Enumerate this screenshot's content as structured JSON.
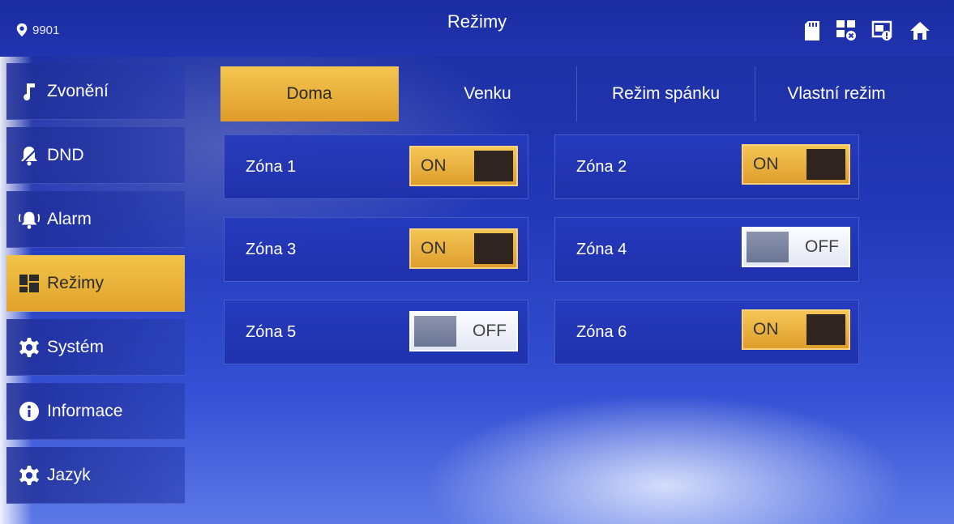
{
  "header": {
    "location_id": "9901",
    "title": "Režimy"
  },
  "status_icons": [
    "sd-card-icon",
    "network-error-icon",
    "camera-alert-icon",
    "home-icon"
  ],
  "sidebar": {
    "items": [
      {
        "label": "Zvonění",
        "icon": "music-note-icon",
        "active": false
      },
      {
        "label": "DND",
        "icon": "bell-mute-icon",
        "active": false
      },
      {
        "label": "Alarm",
        "icon": "alarm-bell-icon",
        "active": false
      },
      {
        "label": "Režimy",
        "icon": "modes-grid-icon",
        "active": true
      },
      {
        "label": "Systém",
        "icon": "gear-icon",
        "active": false
      },
      {
        "label": "Informace",
        "icon": "info-icon",
        "active": false
      },
      {
        "label": "Jazyk",
        "icon": "gear-icon",
        "active": false
      }
    ]
  },
  "tabs": [
    {
      "label": "Doma",
      "active": true
    },
    {
      "label": "Venku",
      "active": false
    },
    {
      "label": "Režim spánku",
      "active": false
    },
    {
      "label": "Vlastní režim",
      "active": false
    }
  ],
  "zones": [
    {
      "label": "Zóna 1",
      "state": "ON"
    },
    {
      "label": "Zóna 2",
      "state": "ON"
    },
    {
      "label": "Zóna 3",
      "state": "ON"
    },
    {
      "label": "Zóna 4",
      "state": "OFF"
    },
    {
      "label": "Zóna 5",
      "state": "OFF"
    },
    {
      "label": "Zóna 6",
      "state": "ON"
    }
  ],
  "colors": {
    "accent_active": "#e8ae36",
    "background": "#2338b8"
  }
}
